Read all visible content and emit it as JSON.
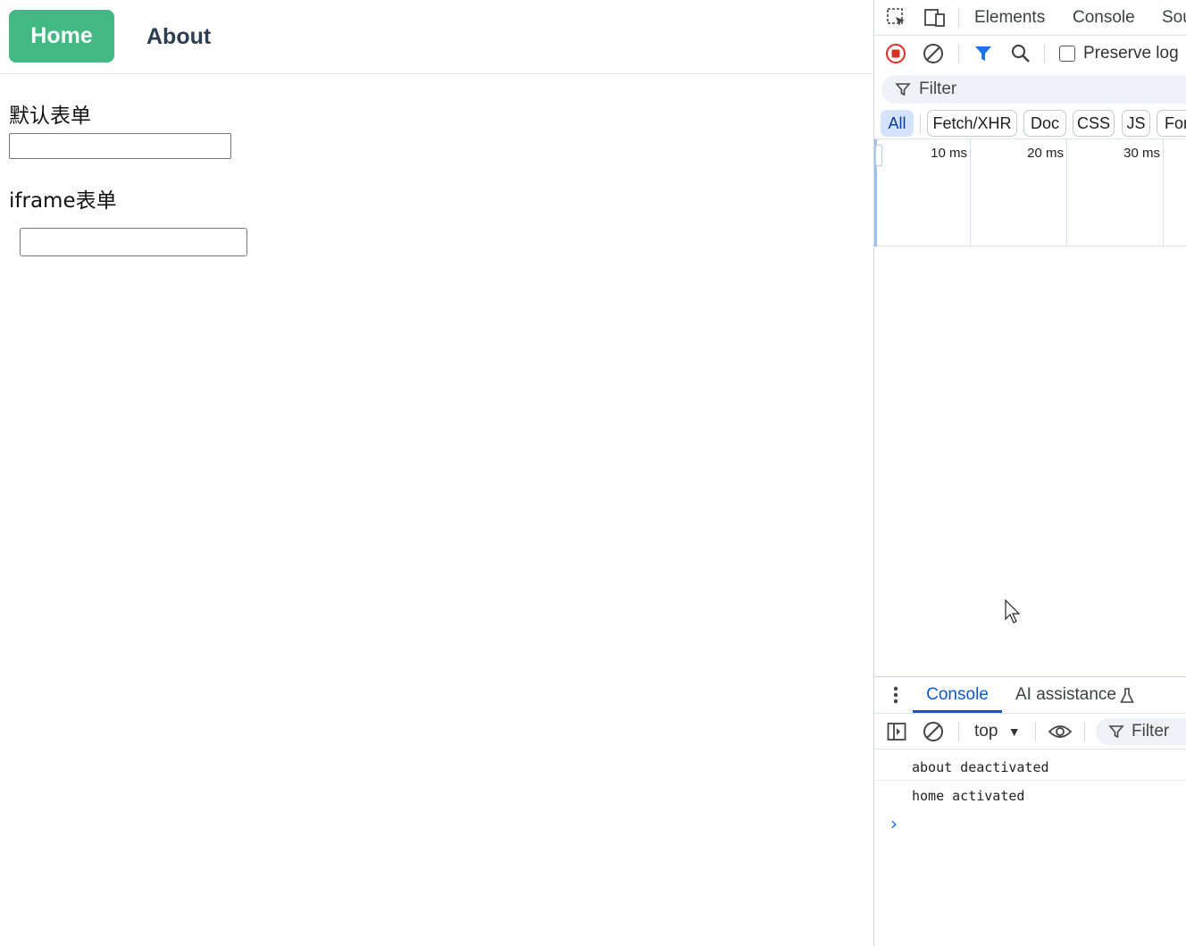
{
  "page": {
    "nav": {
      "home": "Home",
      "about": "About"
    },
    "sections": [
      {
        "title": "默认表单",
        "input_value": ""
      },
      {
        "title": "iframe表单",
        "input_value": ""
      }
    ]
  },
  "devtools": {
    "tabs": [
      "Elements",
      "Console",
      "Sou"
    ],
    "toolbar": {
      "preserve_log": "Preserve log",
      "preserve_checked": false
    },
    "filter_placeholder": "Filter",
    "type_filters": [
      {
        "label": "All",
        "active": true
      },
      {
        "label": "Fetch/XHR",
        "active": false
      },
      {
        "label": "Doc",
        "active": false
      },
      {
        "label": "CSS",
        "active": false
      },
      {
        "label": "JS",
        "active": false
      },
      {
        "label": "For",
        "active": false
      }
    ],
    "timeline_ticks": [
      "10 ms",
      "20 ms",
      "30 ms"
    ],
    "drawer": {
      "tabs": [
        {
          "label": "Console",
          "active": true
        },
        {
          "label": "AI assistance",
          "active": false
        }
      ],
      "context": "top",
      "filter": "Filter",
      "logs": [
        "about deactivated",
        "home activated"
      ],
      "prompt": "›"
    },
    "colors": {
      "accent": "#0b57d0",
      "record": "#d93025",
      "filter_active": "#1a73e8"
    }
  },
  "colors": {
    "home_button": "#42b883",
    "nav_text": "#2c3e50"
  }
}
